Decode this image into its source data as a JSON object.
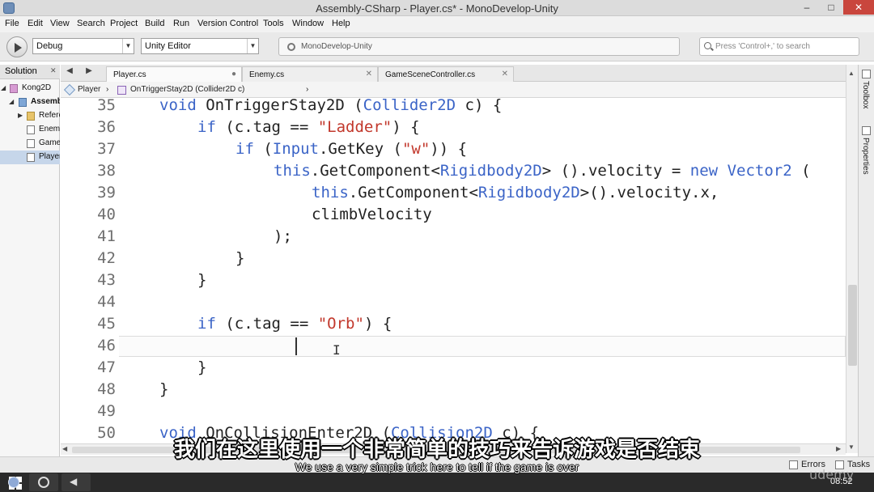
{
  "window": {
    "title": "Assembly-CSharp - Player.cs* - MonoDevelop-Unity",
    "controls": {
      "minimize": "–",
      "maximize": "□",
      "close": "✕"
    }
  },
  "menu": [
    "File",
    "Edit",
    "View",
    "Search",
    "Project",
    "Build",
    "Run",
    "Version Control",
    "Tools",
    "Window",
    "Help"
  ],
  "toolbar": {
    "config_value": "Debug",
    "target_value": "Unity Editor",
    "status_text": "MonoDevelop-Unity",
    "search_placeholder": "Press 'Control+,' to search"
  },
  "solution": {
    "header": "Solution",
    "items": [
      {
        "label": "Kong2D",
        "arrow": "◢",
        "icon": "solution-icon"
      },
      {
        "label": "Assembly-CSharp",
        "arrow": "◢",
        "icon": "project-icon"
      },
      {
        "label": "References",
        "arrow": "▶",
        "icon": "folder-icon"
      },
      {
        "label": "Enemy.cs",
        "arrow": "",
        "icon": "file-icon"
      },
      {
        "label": "GameSceneController.cs",
        "arrow": "",
        "icon": "file-icon"
      },
      {
        "label": "Player.cs",
        "arrow": "",
        "icon": "file-icon"
      }
    ]
  },
  "tabs": [
    {
      "label": "Player.cs",
      "close": "●"
    },
    {
      "label": "Enemy.cs",
      "close": "✕"
    },
    {
      "label": "GameSceneController.cs",
      "close": "✕"
    }
  ],
  "breadcrumb": {
    "class_name": "Player",
    "method_name": "OnTriggerStay2D (Collider2D c)"
  },
  "code": {
    "line_numbers": [
      "35",
      "36",
      "37",
      "38",
      "39",
      "40",
      "41",
      "42",
      "43",
      "44",
      "45",
      "46",
      "47",
      "48",
      "49",
      "50"
    ],
    "current_line": "46"
  },
  "side_pads": {
    "toolbox": "Toolbox",
    "properties": "Properties"
  },
  "statusbar": {
    "errors": "Errors",
    "tasks": "Tasks"
  },
  "taskbar": {
    "clock": "08:52"
  },
  "subtitles": {
    "chinese": "我们在这里使用一个非常简单的技巧来告诉游戏是否结束",
    "english": "We use a very simple trick here to tell if the game is over"
  },
  "watermark": "udemy"
}
